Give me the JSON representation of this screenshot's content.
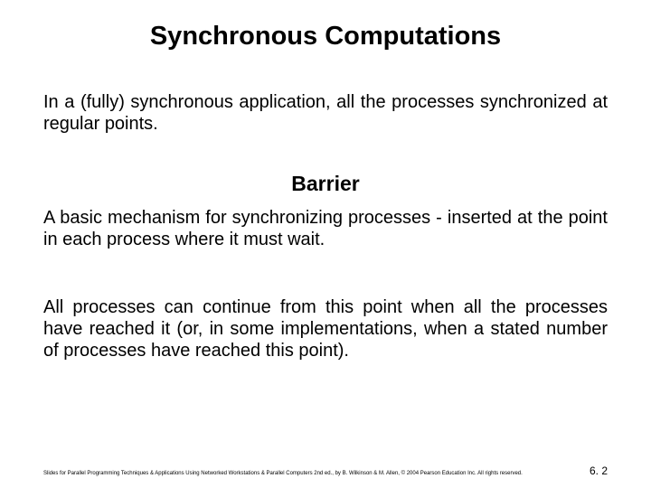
{
  "title": "Synchronous Computations",
  "intro": "In a (fully) synchronous application, all the processes synchronized at regular points.",
  "subheading": "Barrier",
  "body1": "A basic mechanism for synchronizing processes - inserted at the point in each process where it must wait.",
  "body2": "All processes can continue from this point when all the processes have reached it (or, in some implementations, when a stated number of processes have reached this point).",
  "footer": {
    "credits": "Slides for Parallel Programming Techniques & Applications Using Networked Workstations & Parallel Computers 2nd ed., by B. Wilkinson & M. Allen, © 2004 Pearson Education Inc. All rights reserved.",
    "pagenum": "6. 2"
  }
}
